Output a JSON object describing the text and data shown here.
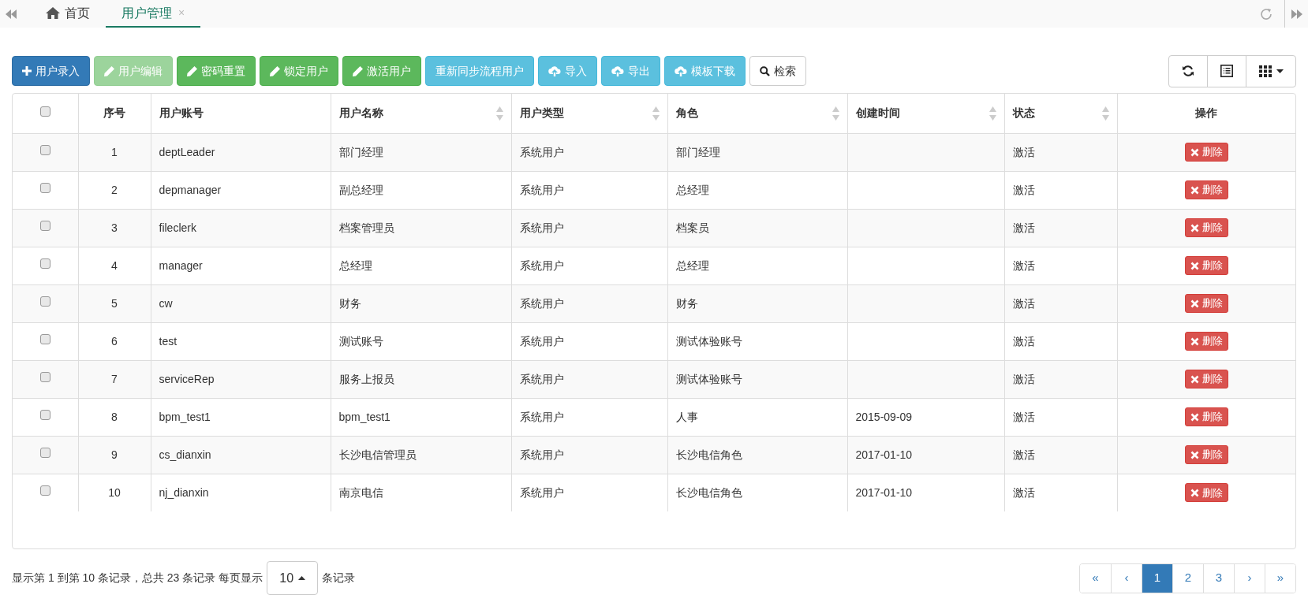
{
  "tabs": [
    {
      "label": "首页",
      "selected": false
    },
    {
      "label": "用户管理",
      "selected": true,
      "close_glyph": "×"
    }
  ],
  "toolbar": [
    {
      "label": "用户录入",
      "kind": "primary",
      "disabled": false
    },
    {
      "label": "用户编辑",
      "kind": "success",
      "disabled": true
    },
    {
      "label": "密码重置",
      "kind": "success",
      "disabled": false
    },
    {
      "label": "锁定用户",
      "kind": "success",
      "disabled": false
    },
    {
      "label": "激活用户",
      "kind": "success",
      "disabled": false
    },
    {
      "label": "重新同步流程用户",
      "kind": "info",
      "disabled": false
    },
    {
      "label": "导入",
      "kind": "info",
      "disabled": false
    },
    {
      "label": "导出",
      "kind": "info",
      "disabled": false
    },
    {
      "label": "模板下载",
      "kind": "info",
      "disabled": false
    },
    {
      "label": "检索",
      "kind": "default",
      "disabled": false
    }
  ],
  "table": {
    "header_checked": false,
    "columns": [
      {
        "label": "序号",
        "sortable": false
      },
      {
        "label": "用户账号",
        "sortable": false
      },
      {
        "label": "用户名称",
        "sortable": true
      },
      {
        "label": "用户类型",
        "sortable": true
      },
      {
        "label": "角色",
        "sortable": true
      },
      {
        "label": "创建时间",
        "sortable": true
      },
      {
        "label": "状态",
        "sortable": true
      },
      {
        "label": "操作",
        "sortable": false
      }
    ],
    "rows": [
      {
        "checked": false,
        "cells": [
          "1",
          "deptLeader",
          "部门经理",
          "系统用户",
          "部门经理",
          "",
          "激活"
        ],
        "action": "删除"
      },
      {
        "checked": false,
        "cells": [
          "2",
          "depmanager",
          "副总经理",
          "系统用户",
          "总经理",
          "",
          "激活"
        ],
        "action": "删除"
      },
      {
        "checked": false,
        "cells": [
          "3",
          "fileclerk",
          "档案管理员",
          "系统用户",
          "档案员",
          "",
          "激活"
        ],
        "action": "删除"
      },
      {
        "checked": false,
        "cells": [
          "4",
          "manager",
          "总经理",
          "系统用户",
          "总经理",
          "",
          "激活"
        ],
        "action": "删除"
      },
      {
        "checked": false,
        "cells": [
          "5",
          "cw",
          "财务",
          "系统用户",
          "财务",
          "",
          "激活"
        ],
        "action": "删除"
      },
      {
        "checked": false,
        "cells": [
          "6",
          "test",
          "测试账号",
          "系统用户",
          "测试体验账号",
          "",
          "激活"
        ],
        "action": "删除"
      },
      {
        "checked": false,
        "cells": [
          "7",
          "serviceRep",
          "服务上报员",
          "系统用户",
          "测试体验账号",
          "",
          "激活"
        ],
        "action": "删除"
      },
      {
        "checked": false,
        "cells": [
          "8",
          "bpm_test1",
          "bpm_test1",
          "系统用户",
          "人事",
          "2015-09-09",
          "激活"
        ],
        "action": "删除"
      },
      {
        "checked": false,
        "cells": [
          "9",
          "cs_dianxin",
          "长沙电信管理员",
          "系统用户",
          "长沙电信角色",
          "2017-01-10",
          "激活"
        ],
        "action": "删除"
      },
      {
        "checked": false,
        "cells": [
          "10",
          "nj_dianxin",
          "南京电信",
          "系统用户",
          "长沙电信角色",
          "2017-01-10",
          "激活"
        ],
        "action": "删除"
      }
    ]
  },
  "footer": {
    "summary": "显示第 1 到第 10 条记录，总共 23 条记录 每页显示",
    "page_size": "10",
    "suffix": "条记录"
  },
  "pagination": [
    {
      "label": "«",
      "selected": false
    },
    {
      "label": "‹",
      "selected": false
    },
    {
      "label": "1",
      "selected": true
    },
    {
      "label": "2",
      "selected": false
    },
    {
      "label": "3",
      "selected": false
    },
    {
      "label": "›",
      "selected": false
    },
    {
      "label": "»",
      "selected": false
    }
  ]
}
